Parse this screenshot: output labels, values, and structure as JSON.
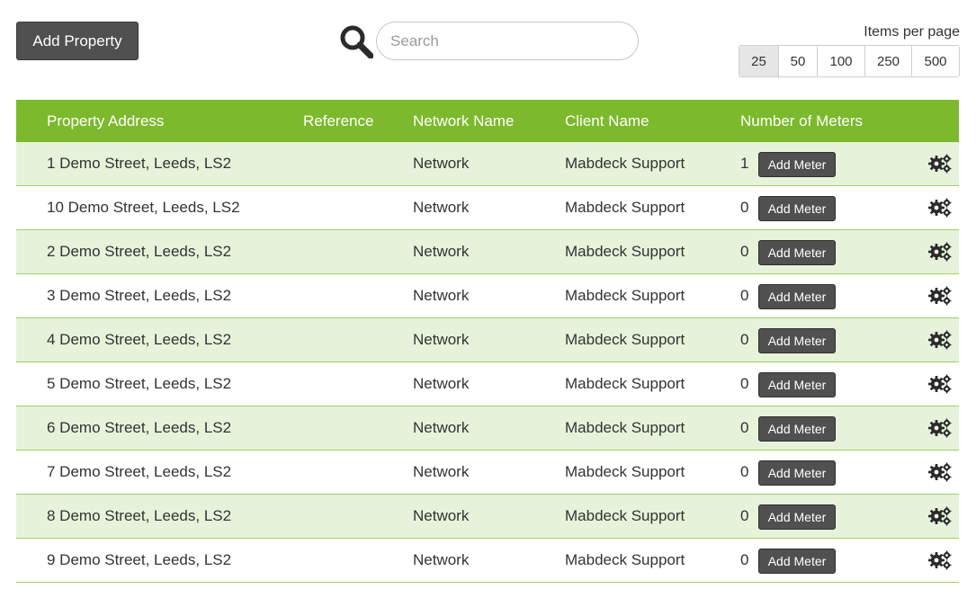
{
  "toolbar": {
    "add_property_label": "Add Property",
    "search_placeholder": "Search",
    "search_value": "",
    "items_per_page_label": "Items per page",
    "page_sizes": [
      "25",
      "50",
      "100",
      "250",
      "500"
    ],
    "selected_page_size": "25"
  },
  "table": {
    "columns": [
      "Property Address",
      "Reference",
      "Network Name",
      "Client Name",
      "Number of Meters"
    ],
    "add_meter_label": "Add Meter",
    "rows": [
      {
        "address": "1 Demo Street, Leeds, LS2",
        "reference": "",
        "network": "Network",
        "client": "Mabdeck Support",
        "meters": "1"
      },
      {
        "address": "10 Demo Street, Leeds, LS2",
        "reference": "",
        "network": "Network",
        "client": "Mabdeck Support",
        "meters": "0"
      },
      {
        "address": "2 Demo Street, Leeds, LS2",
        "reference": "",
        "network": "Network",
        "client": "Mabdeck Support",
        "meters": "0"
      },
      {
        "address": "3 Demo Street, Leeds, LS2",
        "reference": "",
        "network": "Network",
        "client": "Mabdeck Support",
        "meters": "0"
      },
      {
        "address": "4 Demo Street, Leeds, LS2",
        "reference": "",
        "network": "Network",
        "client": "Mabdeck Support",
        "meters": "0"
      },
      {
        "address": "5 Demo Street, Leeds, LS2",
        "reference": "",
        "network": "Network",
        "client": "Mabdeck Support",
        "meters": "0"
      },
      {
        "address": "6 Demo Street, Leeds, LS2",
        "reference": "",
        "network": "Network",
        "client": "Mabdeck Support",
        "meters": "0"
      },
      {
        "address": "7 Demo Street, Leeds, LS2",
        "reference": "",
        "network": "Network",
        "client": "Mabdeck Support",
        "meters": "0"
      },
      {
        "address": "8 Demo Street, Leeds, LS2",
        "reference": "",
        "network": "Network",
        "client": "Mabdeck Support",
        "meters": "0"
      },
      {
        "address": "9 Demo Street, Leeds, LS2",
        "reference": "",
        "network": "Network",
        "client": "Mabdeck Support",
        "meters": "0"
      }
    ]
  },
  "icons": {
    "search": "search-icon",
    "row_settings": "gears-icon"
  },
  "colors": {
    "header_bg": "#7cb92c",
    "row_alt_bg": "#e6f2d9",
    "button_bg": "#505050"
  }
}
